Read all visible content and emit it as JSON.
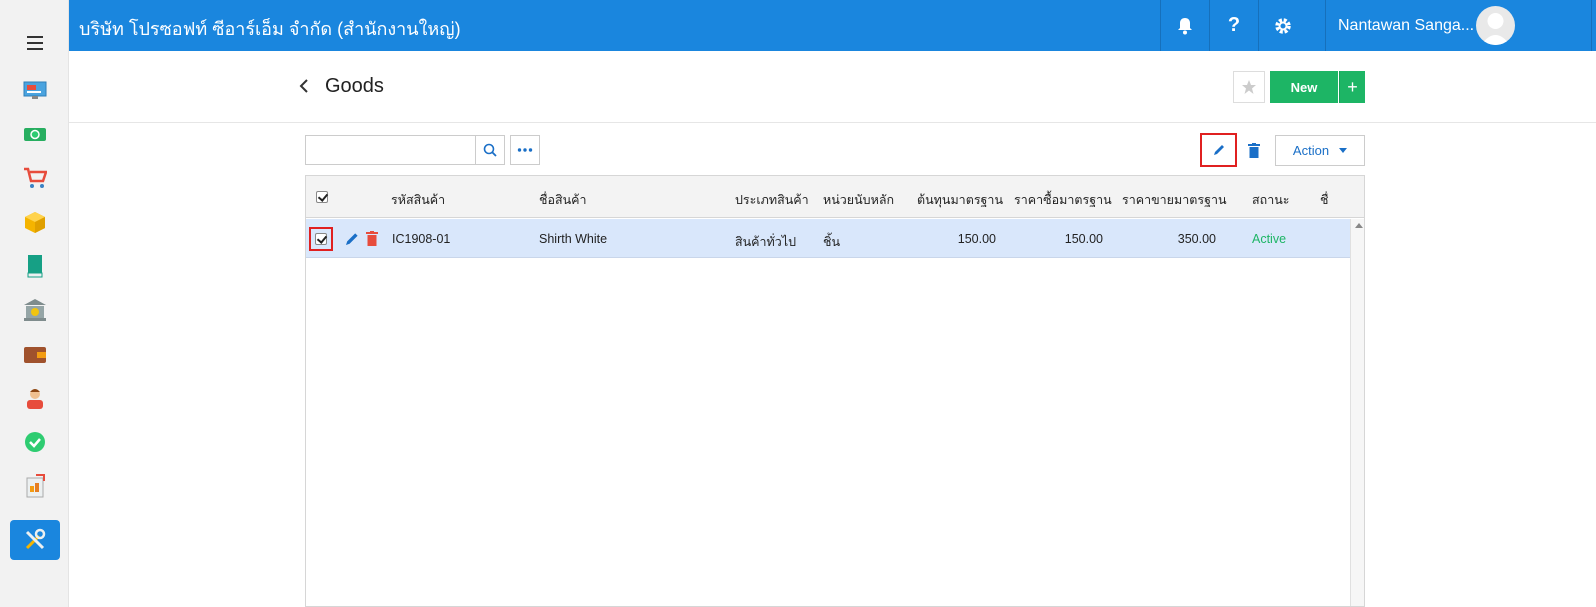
{
  "topbar": {
    "company": "บริษัท โปรซอฟท์ ซีอาร์เอ็ม จำกัด (สำนักงานใหญ่)",
    "user_name": "Nantawan Sanga..."
  },
  "page": {
    "title": "Goods"
  },
  "toolbar": {
    "new_label": "New",
    "new_plus": "+",
    "action_label": "Action",
    "search_value": ""
  },
  "grid": {
    "columns": [
      "รหัสสินค้า",
      "ชื่อสินค้า",
      "ประเภทสินค้า",
      "หน่วยนับหลัก",
      "ต้นทุนมาตรฐาน",
      "ราคาซื้อมาตรฐาน",
      "ราคาขายมาตรฐาน",
      "สถานะ",
      "ชื่"
    ],
    "rows": [
      {
        "code": "IC1908-01",
        "name": "Shirth White",
        "type": "สินค้าทั่วไป",
        "unit": "ชิ้น",
        "std_cost": "150.00",
        "std_buy": "150.00",
        "std_sell": "350.00",
        "status": "Active"
      }
    ]
  },
  "colors": {
    "primary": "#1a86de",
    "success": "#1db565",
    "danger": "#e02020",
    "row_selected": "#d9e7fb"
  },
  "icons": {
    "sidebar": [
      "dashboard-icon",
      "money-icon",
      "cart-icon",
      "box-icon",
      "book-icon",
      "bank-icon",
      "wallet-icon",
      "person-icon",
      "check-icon",
      "report-icon",
      "tools-icon"
    ]
  }
}
